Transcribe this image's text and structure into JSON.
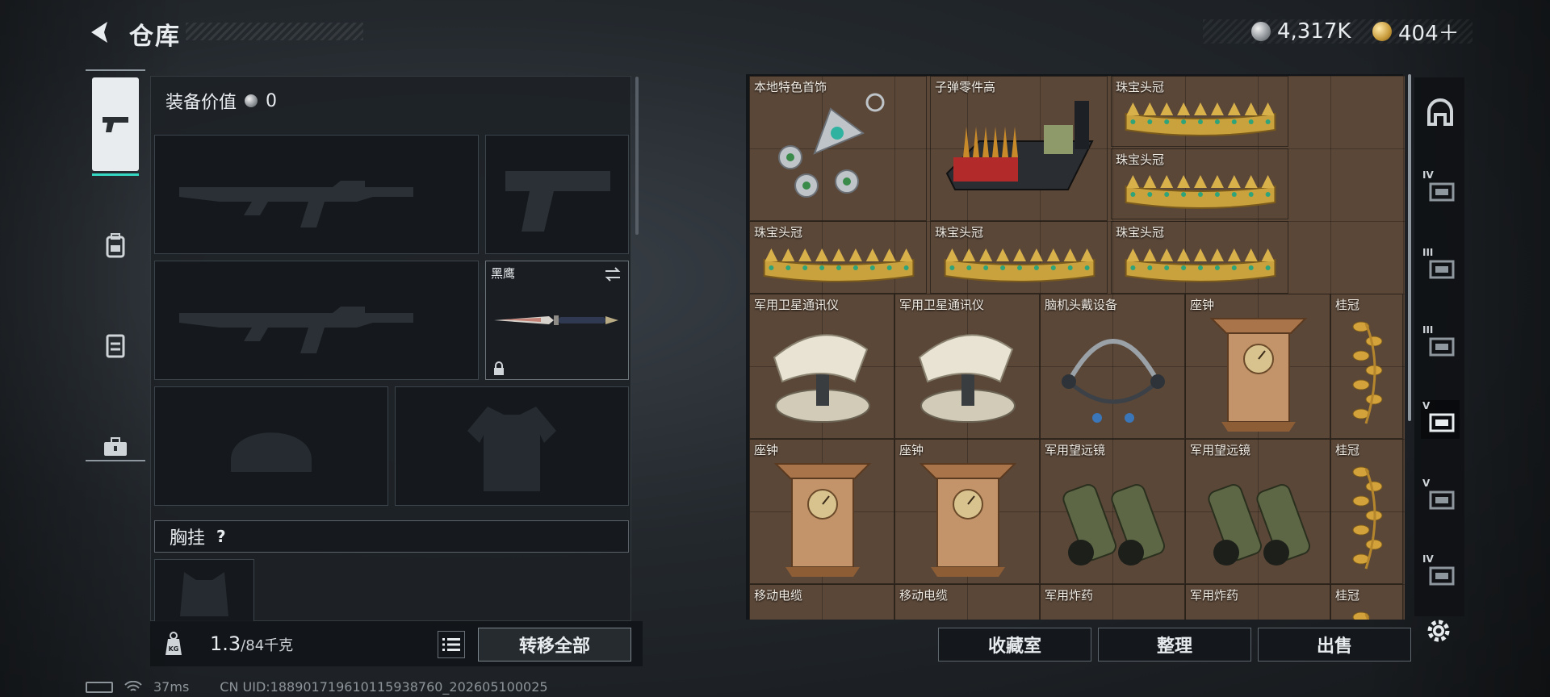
{
  "header": {
    "title": "仓库",
    "silver_amount": "4,317K",
    "gold_amount": "404＋"
  },
  "left_tabs": [
    {
      "name": "firearms"
    },
    {
      "name": "backpack"
    },
    {
      "name": "vest"
    },
    {
      "name": "toolbox"
    }
  ],
  "equipment": {
    "value_label": "装备价值",
    "value": "0",
    "melee_name": "黑鹰",
    "chest_rig_label": "胸挂",
    "help_label": "?"
  },
  "capacity": {
    "current": "1.3",
    "max": "/84千克",
    "weight_icon_text": "KG"
  },
  "buttons": {
    "transfer_all": "转移全部",
    "collection_room": "收藏室",
    "organize": "整理",
    "sell": "出售"
  },
  "status": {
    "ping": "37ms",
    "uid": "CN UID:1889017196101159387­60_202605100025"
  },
  "items": [
    {
      "name": "本地特色首饰",
      "kind": "jewelry"
    },
    {
      "name": "子弹零件高",
      "kind": "ammo-parts"
    },
    {
      "name": "珠宝头冠",
      "kind": "crown"
    },
    {
      "name": "珠宝头冠",
      "kind": "crown"
    },
    {
      "name": "珠宝头冠",
      "kind": "crown"
    },
    {
      "name": "珠宝头冠",
      "kind": "crown"
    },
    {
      "name": "珠宝头冠",
      "kind": "crown"
    },
    {
      "name": "军用卫星通讯仪",
      "kind": "satcom"
    },
    {
      "name": "军用卫星通讯仪",
      "kind": "satcom"
    },
    {
      "name": "脑机头戴设备",
      "kind": "headset"
    },
    {
      "name": "座钟",
      "kind": "clock"
    },
    {
      "name": "桂冠",
      "kind": "laurel"
    },
    {
      "name": "座钟",
      "kind": "clock"
    },
    {
      "name": "座钟",
      "kind": "clock"
    },
    {
      "name": "军用望远镜",
      "kind": "binoculars"
    },
    {
      "name": "军用望远镜",
      "kind": "binoculars"
    },
    {
      "name": "桂冠",
      "kind": "laurel"
    },
    {
      "name": "移动电缆",
      "kind": "cable"
    },
    {
      "name": "移动电缆",
      "kind": "cable"
    },
    {
      "name": "军用炸药",
      "kind": "explosive"
    },
    {
      "name": "军用炸药",
      "kind": "explosive"
    },
    {
      "name": "桂冠",
      "kind": "laurel"
    }
  ],
  "right_tabs": [
    {
      "label": "",
      "icon": "helmet-icon"
    },
    {
      "label": "IV",
      "icon": "case-iv-icon"
    },
    {
      "label": "III",
      "icon": "case-iii-warning-icon"
    },
    {
      "label": "III",
      "icon": "case-iii-icon"
    },
    {
      "label": "V",
      "icon": "case-v-active-icon"
    },
    {
      "label": "V",
      "icon": "case-v-icon"
    },
    {
      "label": "IV",
      "icon": "case-iv-b-icon"
    }
  ],
  "colors": {
    "accent_teal": "#35d8c2",
    "grid_bg": "#5a4738",
    "gold": "#c79a3a"
  }
}
